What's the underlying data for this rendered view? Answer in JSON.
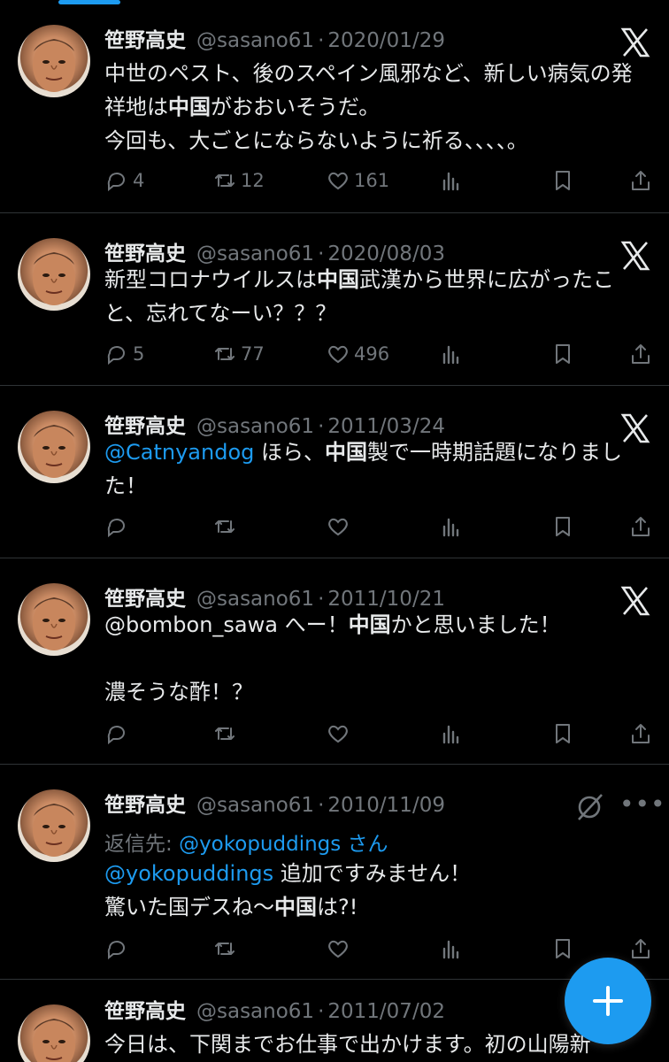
{
  "tweets": [
    {
      "name": "笹野高史",
      "handle": "@sasano61",
      "separator": "·",
      "date": "2020/01/29",
      "segments": [
        {
          "t": "中世のペスト、後のスペイン風邪など、新しい病気の発祥地は"
        },
        {
          "t": "中国",
          "b": true
        },
        {
          "t": "がおおいそうだ。\n今回も、大ごとにならないように祈る、、、、。"
        }
      ],
      "replies": "4",
      "retweets": "12",
      "likes": "161"
    },
    {
      "name": "笹野高史",
      "handle": "@sasano61",
      "separator": "·",
      "date": "2020/08/03",
      "segments": [
        {
          "t": "新型コロナウイルスは"
        },
        {
          "t": "中国",
          "b": true
        },
        {
          "t": "武漢から世界に広がったこと、忘れてなーい？？？"
        }
      ],
      "replies": "5",
      "retweets": "77",
      "likes": "496"
    },
    {
      "name": "笹野高史",
      "handle": "@sasano61",
      "separator": "·",
      "date": "2011/03/24",
      "segments": [
        {
          "t": "@Catnyandog",
          "m": true
        },
        {
          "t": " ほら、"
        },
        {
          "t": "中国",
          "b": true
        },
        {
          "t": "製で一時期話題になりました！"
        }
      ],
      "replies": "",
      "retweets": "",
      "likes": ""
    },
    {
      "name": "笹野高史",
      "handle": "@sasano61",
      "separator": "·",
      "date": "2011/10/21",
      "segments": [
        {
          "t": "@bombon_sawa へー！"
        },
        {
          "t": "中国",
          "b": true
        },
        {
          "t": "かと思いました！\n\n濃そうな酢！？"
        }
      ],
      "replies": "",
      "retweets": "",
      "likes": ""
    },
    {
      "name": "笹野高史",
      "handle": "@sasano61",
      "separator": "·",
      "date": "2010/11/09",
      "reply_to_label": "返信先: ",
      "reply_to_handle": "@yokopuddings さん",
      "segments": [
        {
          "t": "@yokopuddings",
          "m": true
        },
        {
          "t": " 追加ですみません！\n驚いた国デスね〜"
        },
        {
          "t": "中国",
          "b": true
        },
        {
          "t": "は?!"
        }
      ],
      "replies": "",
      "retweets": "",
      "likes": ""
    },
    {
      "name": "笹野高史",
      "handle": "@sasano61",
      "separator": "·",
      "date": "2011/07/02",
      "segments": [
        {
          "t": "今日は、下関までお仕事で出かけます。初の山陽新"
        }
      ],
      "replies": "",
      "retweets": "",
      "likes": ""
    }
  ],
  "colors": {
    "background": "#000000",
    "text": "#e7e9ea",
    "muted": "#71767b",
    "accent": "#1d9bf0",
    "divider": "#2f3336"
  },
  "icons": [
    "x-logo-icon",
    "reply-icon",
    "retweet-icon",
    "like-icon",
    "views-icon",
    "bookmark-icon",
    "share-icon",
    "more-icon",
    "grok-icon",
    "plus-icon"
  ]
}
